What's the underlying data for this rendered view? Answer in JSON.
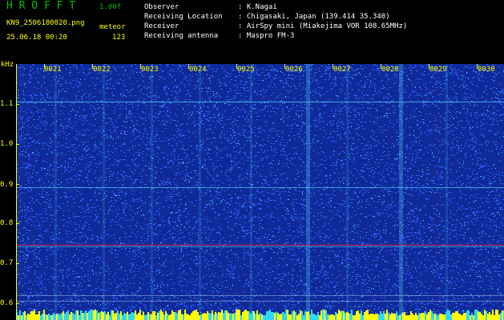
{
  "app": {
    "title": "H R O F F T",
    "version": "1.00f",
    "filename": "KN9_2506180020.png",
    "mode": "meteor",
    "datetime": "25.06.18 00:20",
    "count": "123"
  },
  "info": [
    {
      "label": "Observer",
      "value": ": K.Nagai"
    },
    {
      "label": "Receiving Location",
      "value": ": Chigasaki, Japan (139.414 35.340)"
    },
    {
      "label": "Receiver",
      "value": ": AirSpy mini (Miakejima VOR 108.65MHz)"
    },
    {
      "label": "Receiving antenna",
      "value": ": Maspro FM-3"
    }
  ],
  "plot": {
    "y_unit": "kHz",
    "y_ticks": [
      "1.1",
      "1.0",
      "0.9",
      "0.8",
      "0.7",
      "0.6"
    ],
    "time_ticks": [
      "0021",
      "0022",
      "0023",
      "0024",
      "0025",
      "0026",
      "0027",
      "0028",
      "0029",
      "0030"
    ],
    "colors": {
      "background": "#102a9a",
      "noise": "#2f63ff",
      "bright": "#4fe3ff",
      "red": "#ff3030",
      "axis": "#ffff00"
    }
  }
}
